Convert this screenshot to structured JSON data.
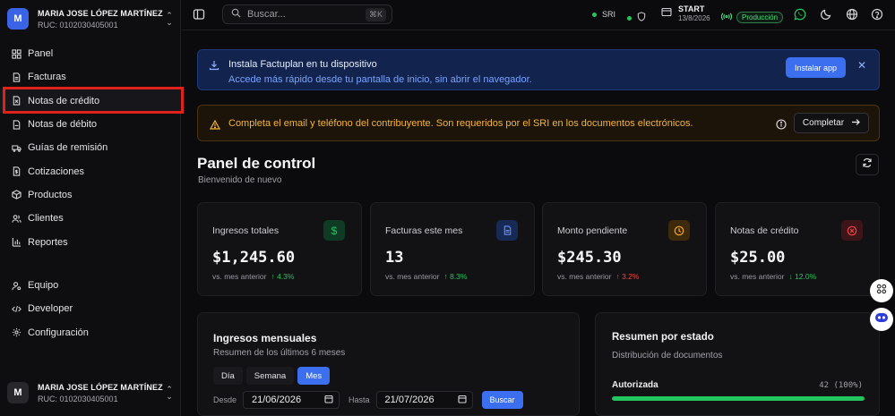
{
  "org": {
    "avatar": "M",
    "name": "MARIA JOSE LÓPEZ MARTÍNEZ",
    "ruc": "RUC: 0102030405001"
  },
  "nav": [
    {
      "label": "Panel",
      "icon": "grid-icon"
    },
    {
      "label": "Facturas",
      "icon": "file-invoice-icon"
    },
    {
      "label": "Notas de crédito",
      "icon": "file-x-icon"
    },
    {
      "label": "Notas de débito",
      "icon": "file-icon"
    },
    {
      "label": "Guías de remisión",
      "icon": "truck-icon"
    },
    {
      "label": "Cotizaciones",
      "icon": "file-dollar-icon"
    },
    {
      "label": "Productos",
      "icon": "package-icon"
    },
    {
      "label": "Clientes",
      "icon": "users-icon"
    },
    {
      "label": "Reportes",
      "icon": "bar-chart-icon"
    }
  ],
  "nav2": [
    {
      "label": "Equipo",
      "icon": "user-cog-icon"
    },
    {
      "label": "Developer",
      "icon": "code-icon"
    },
    {
      "label": "Configuración",
      "icon": "gear-icon"
    }
  ],
  "user": {
    "avatar": "M",
    "name": "MARIA JOSE LÓPEZ MARTÍNEZ",
    "ruc": "RUC: 0102030405001"
  },
  "topbar": {
    "search_placeholder": "Buscar...",
    "shortcut": "⌘K",
    "sri": "SRI",
    "start_title": "START",
    "start_date": "13/8/2026",
    "environment": "Producción",
    "status_color": "#22c55e"
  },
  "install_banner": {
    "title": "Instala Factuplan en tu dispositivo",
    "subtitle": "Accede más rápido desde tu pantalla de inicio, sin abrir el navegador.",
    "button": "Instalar app",
    "close": "✕"
  },
  "warning_banner": {
    "text": "Completa el email y teléfono del contribuyente. Son requeridos por el SRI en los documentos electrónicos.",
    "button": "Completar"
  },
  "page": {
    "title": "Panel de control",
    "subtitle": "Bienvenido de nuevo"
  },
  "stats": [
    {
      "label": "Ingresos totales",
      "value": "$1,245.60",
      "foot": "vs. mes anterior",
      "trend": "↑ 4.3%",
      "dir": "up",
      "icon": "dollar-icon",
      "icon_bg": "#0f3a24",
      "icon_color": "#22c55e"
    },
    {
      "label": "Facturas este mes",
      "value": "13",
      "foot": "vs. mes anterior",
      "trend": "↑ 8.3%",
      "dir": "up",
      "icon": "document-icon",
      "icon_bg": "#172a55",
      "icon_color": "#6b93f5"
    },
    {
      "label": "Monto pendiente",
      "value": "$245.30",
      "foot": "vs. mes anterior",
      "trend": "↑ 3.2%",
      "dir": "down",
      "icon": "clock-icon",
      "icon_bg": "#3d2a0a",
      "icon_color": "#f5a524"
    },
    {
      "label": "Notas de crédito",
      "value": "$25.00",
      "foot": "vs. mes anterior",
      "trend": "↓ 12.0%",
      "dir": "up",
      "icon": "x-circle-icon",
      "icon_bg": "#3d1518",
      "icon_color": "#ef4444"
    }
  ],
  "income": {
    "title": "Ingresos mensuales",
    "subtitle": "Resumen de los últimos 6 meses",
    "segments": [
      "Día",
      "Semana",
      "Mes"
    ],
    "active_segment": 2,
    "from_label": "Desde",
    "from_value": "21/06/2026",
    "to_label": "Hasta",
    "to_value": "21/07/2026",
    "search_button": "Buscar"
  },
  "status_summary": {
    "title": "Resumen por estado",
    "subtitle": "Distribución de documentos",
    "rows": [
      {
        "label": "Autorizada",
        "value": "42 (100%)",
        "fraction": 1.0
      }
    ]
  }
}
